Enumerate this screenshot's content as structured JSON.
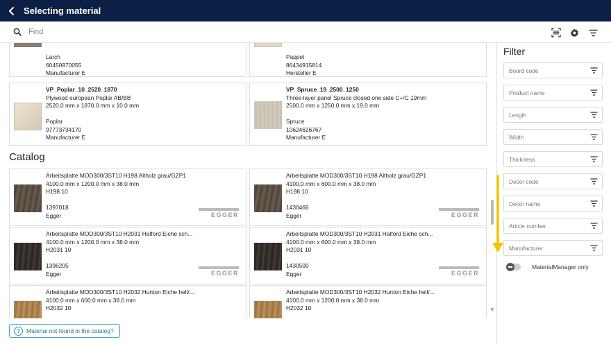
{
  "header": {
    "title": "Selecting material",
    "back_icon": "chevron-left-icon"
  },
  "search": {
    "placeholder": "Find",
    "icons": [
      "search-icon",
      "barcode-scan-icon",
      "gear-icon",
      "filter-icon"
    ]
  },
  "recent_cards": [
    {
      "lines": [
        "Larch",
        "60450970055",
        "Manufacturer E"
      ],
      "thumb_color": "#8a7c70"
    },
    {
      "lines": [
        "Pappel",
        "86434915814",
        "Hersteller E"
      ],
      "thumb_color": "#e3d6c4"
    },
    {
      "title": "VP_Poplar_10_2520_1870",
      "lines": [
        "Plywood european Poplar AB/BB",
        "2520.0 mm x 1870.0 mm x 10.0 mm",
        "",
        "Poplar",
        "97773734170",
        "Manufacturer E"
      ],
      "thumb_color": "#e0d2c2"
    },
    {
      "title": "VP_Spruce_19_2500_1250",
      "lines": [
        "Three-layer panel Spruce closed one side C+/C 19mm",
        "2500.0 mm x 1250.0 mm x 19.0 mm",
        "",
        "Spruce",
        "10624626767",
        "Manufacturer E"
      ],
      "thumb_color": "#cfc9bb"
    }
  ],
  "catalog": {
    "title": "Catalog",
    "items": [
      {
        "lines": [
          "Arbeitsplatte MOD300/3ST10 H198 Altholz grau/GZP1",
          "4100.0 mm x 1200.0 mm x 38.0 mm",
          "H198 10",
          "",
          "1397018",
          "Egger"
        ],
        "logo": "EGGER",
        "thumb_color": "#5b4d42"
      },
      {
        "lines": [
          "Arbeitsplatte MOD300/3ST10 H198 Altholz grau/GZP1",
          "4100.0 mm x 600.0 mm x 38.0 mm",
          "H198 10",
          "",
          "1430466",
          "Egger"
        ],
        "logo": "EGGER",
        "thumb_color": "#5b4d42"
      },
      {
        "lines": [
          "Arbeitsplatte MOD300/3ST10 H2031 Halford Eiche sch...",
          "4100.0 mm x 1200.0 mm x 38.0 mm",
          "H2031 10",
          "",
          "1396205",
          "Egger"
        ],
        "logo": "EGGER",
        "thumb_color": "#3a332e"
      },
      {
        "lines": [
          "Arbeitsplatte MOD300/3ST10 H2031 Halford Eiche sch...",
          "4100.0 mm x 600.0 mm x 38.0 mm",
          "H2031 10",
          "",
          "1430500",
          "Egger"
        ],
        "logo": "EGGER",
        "thumb_color": "#3a332e"
      },
      {
        "lines": [
          "Arbeitsplatte MOD300/3ST10 H2032 Hunton Eiche hell/...",
          "4100.0 mm x 600.0 mm x 38.0 mm",
          "H2032 10"
        ],
        "logo": "",
        "thumb_color": "#b48a55"
      },
      {
        "lines": [
          "Arbeitsplatte MOD300/3ST10 H2032 Hunton Eiche hell/...",
          "4100.0 mm x 1200.0 mm x 38.0 mm",
          "H2032 10"
        ],
        "logo": "",
        "thumb_color": "#b48a55"
      }
    ]
  },
  "not_found_button": "Material not found in the catalog?",
  "filter": {
    "title": "Filter",
    "fields": [
      "Board code",
      "Product name",
      "Length",
      "Width",
      "Thickness",
      "Decor code",
      "Decor name",
      "Article number",
      "Manufacturer"
    ],
    "toggle_label": "MaterialManager only",
    "toggle_on": false
  },
  "colors": {
    "header_bg": "#0c1f45",
    "accent": "#3aa5c8",
    "hint_arrow": "#f5c400"
  }
}
